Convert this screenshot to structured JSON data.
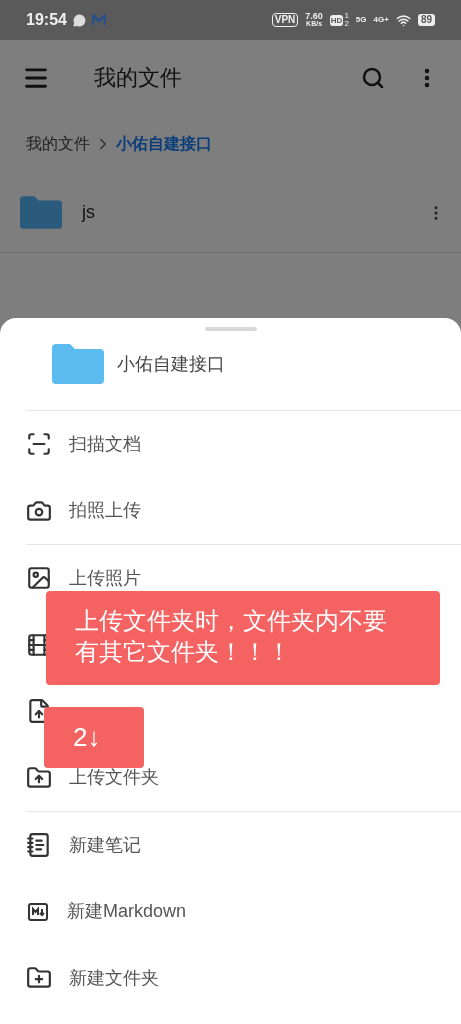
{
  "status_bar": {
    "time": "19:54",
    "vpn": "VPN",
    "speed": "7.60",
    "speed_unit": "KB/s",
    "hd": "HD",
    "hd_sims": [
      "1",
      "2"
    ],
    "network_1": "5G",
    "network_2": "4G+",
    "battery": "89"
  },
  "app_bar": {
    "title": "我的文件"
  },
  "breadcrumb": [
    {
      "label": "我的文件",
      "selected": false
    },
    {
      "label": "小佑自建接口",
      "selected": true
    }
  ],
  "files": [
    {
      "name": "js",
      "kind": "folder"
    }
  ],
  "sheet": {
    "folder": "小佑自建接口",
    "groups": [
      [
        {
          "kind": "scan",
          "label": "扫描文档"
        },
        {
          "kind": "camera",
          "label": "拍照上传"
        }
      ],
      [
        {
          "kind": "image",
          "label": "上传照片"
        },
        {
          "kind": "video"
        },
        {
          "kind": "file"
        },
        {
          "kind": "upload_folder",
          "label": "上传文件夹"
        }
      ],
      [
        {
          "kind": "note",
          "label": "新建笔记"
        },
        {
          "kind": "markdown",
          "label": "新建Markdown"
        },
        {
          "kind": "new_folder",
          "label": "新建文件夹"
        }
      ]
    ]
  },
  "callouts": [
    {
      "kind": "note",
      "text": "上传文件夹时，文件夹内不要有其它文件夹！！！"
    },
    {
      "kind": "step",
      "text": "2↓"
    }
  ]
}
